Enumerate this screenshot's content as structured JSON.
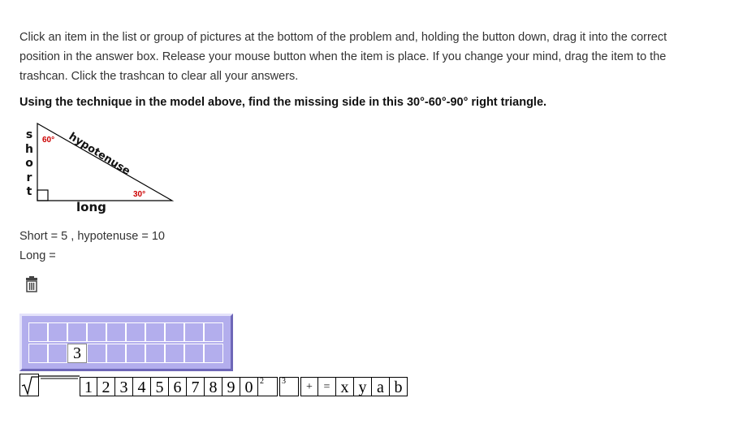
{
  "instructions": "Click an item in the list or group of pictures at the bottom of the problem and, holding the button down, drag it into the correct position in the answer box. Release your mouse button when the item is place. If you change your mind, drag the item to the trashcan. Click the trashcan to clear all your answers.",
  "question": "Using the technique in the model above, find the missing side in this 30°-60°-90° right triangle.",
  "figure": {
    "short_letters": [
      "s",
      "h",
      "o",
      "r",
      "t"
    ],
    "hypotenuse_label": "hypotenuse",
    "long_label": "long",
    "angle_top": "60°",
    "angle_bottom": "30°"
  },
  "given": {
    "line1": "Short = 5 , hypotenuse = 10",
    "line2": "Long ="
  },
  "trash": {
    "icon": "trash-icon"
  },
  "answer_box": {
    "cell": "3"
  },
  "palette": {
    "sqrt_icon": "square-root-icon",
    "fraction_icon": "fraction-bar-icon",
    "keys": [
      "1",
      "2",
      "3",
      "4",
      "5",
      "6",
      "7",
      "8",
      "9",
      "0",
      "2",
      "3",
      "+",
      "=",
      "x",
      "y",
      "a",
      "b"
    ]
  },
  "colors": {
    "answer_box_fill": "#b3aeed",
    "angle_label": "#cc0000"
  }
}
